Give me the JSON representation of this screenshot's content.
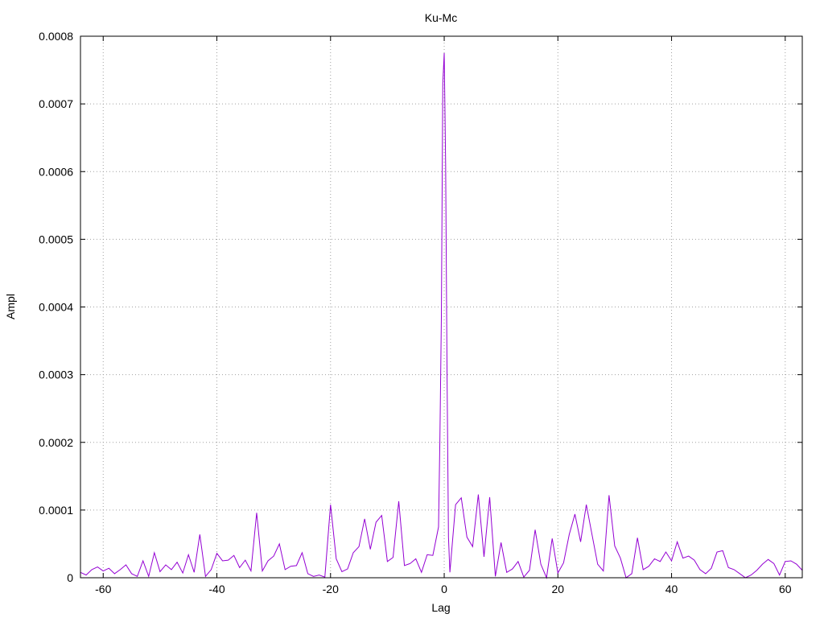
{
  "chart_data": {
    "type": "line",
    "title": "Ku-Mc",
    "xlabel": "Lag",
    "ylabel": "Ampl",
    "xlim": [
      -64,
      63
    ],
    "ylim": [
      0,
      0.0008
    ],
    "x_ticks": [
      -60,
      -40,
      -20,
      0,
      20,
      40,
      60
    ],
    "y_ticks": [
      0,
      0.0001,
      0.0002,
      0.0003,
      0.0004,
      0.0005,
      0.0006,
      0.0007,
      0.0008
    ],
    "x_tick_labels": [
      "-60",
      "-40",
      "-20",
      "0",
      "20",
      "40",
      "60"
    ],
    "y_tick_labels": [
      "0",
      "0.0001",
      "0.0002",
      "0.0003",
      "0.0004",
      "0.0005",
      "0.0006",
      "0.0007",
      "0.0008"
    ],
    "grid": true,
    "legend": "none",
    "colors": {
      "series": "#9400d3",
      "grid": "#a0a0a0",
      "axis": "#000000"
    },
    "series": [
      {
        "x": [
          -64,
          -63,
          -62,
          -61,
          -60,
          -59,
          -58,
          -57,
          -56,
          -55,
          -54,
          -53,
          -52,
          -51,
          -50,
          -49,
          -48,
          -47,
          -46,
          -45,
          -44,
          -43,
          -42,
          -41,
          -40,
          -39,
          -38,
          -37,
          -36,
          -35,
          -34,
          -33,
          -32,
          -31,
          -30,
          -29,
          -28,
          -27,
          -26,
          -25,
          -24,
          -23,
          -22,
          -21,
          -20,
          -19,
          -18,
          -17,
          -16,
          -15,
          -14,
          -13,
          -12,
          -11,
          -10,
          -9,
          -8,
          -7,
          -6,
          -5,
          -4,
          -3,
          -2,
          -1,
          -0.75,
          -0.5,
          -0.25,
          0,
          0.25,
          0.5,
          0.75,
          1,
          2,
          3,
          4,
          5,
          6,
          7,
          8,
          9,
          10,
          11,
          12,
          13,
          14,
          15,
          16,
          17,
          18,
          19,
          20,
          21,
          22,
          23,
          24,
          25,
          26,
          27,
          28,
          29,
          30,
          31,
          32,
          33,
          34,
          35,
          36,
          37,
          38,
          39,
          40,
          41,
          42,
          43,
          44,
          45,
          46,
          47,
          48,
          49,
          50,
          51,
          52,
          53,
          54,
          55,
          56,
          57,
          58,
          59,
          60,
          61,
          62,
          63
        ],
        "values": [
          8e-06,
          4e-06,
          1.2e-05,
          1.6e-05,
          1e-05,
          1.4e-05,
          6e-06,
          1.2e-05,
          1.9e-05,
          6e-06,
          2e-06,
          2.5e-05,
          2e-06,
          3.7e-05,
          9e-06,
          1.9e-05,
          1.2e-05,
          2.3e-05,
          7e-06,
          3.4e-05,
          8e-06,
          6.4e-05,
          2e-06,
          1.2e-05,
          3.6e-05,
          2.5e-05,
          2.6e-05,
          3.3e-05,
          1.5e-05,
          2.6e-05,
          1e-05,
          9.6e-05,
          1e-05,
          2.5e-05,
          3.2e-05,
          5e-05,
          1.2e-05,
          1.7e-05,
          1.8e-05,
          3.7e-05,
          6e-06,
          2e-06,
          4e-06,
          1e-06,
          0.000108,
          2.8e-05,
          9e-06,
          1.3e-05,
          3.7e-05,
          4.6e-05,
          8.7e-05,
          4.2e-05,
          8.2e-05,
          9.2e-05,
          2.4e-05,
          3e-05,
          0.000113,
          1.8e-05,
          2.1e-05,
          2.8e-05,
          8e-06,
          3.4e-05,
          3.3e-05,
          7.5e-05,
          0.00021,
          0.000385,
          0.00073,
          0.000775,
          0.00061,
          0.0003,
          6e-05,
          8e-06,
          0.000108,
          0.000118,
          6e-05,
          4.6e-05,
          0.000123,
          3.1e-05,
          0.000119,
          2e-06,
          5.2e-05,
          8e-06,
          1.3e-05,
          2.4e-05,
          1e-06,
          1.1e-05,
          7.1e-05,
          2e-05,
          0.0,
          5.8e-05,
          7e-06,
          2.2e-05,
          6.4e-05,
          9.4e-05,
          5.3e-05,
          0.000108,
          6.4e-05,
          2e-05,
          1e-05,
          0.000122,
          4.7e-05,
          2.9e-05,
          0.0,
          6e-06,
          5.9e-05,
          1.2e-05,
          1.7e-05,
          2.8e-05,
          2.4e-05,
          3.8e-05,
          2.5e-05,
          5.3e-05,
          2.9e-05,
          3.2e-05,
          2.6e-05,
          1.2e-05,
          6e-06,
          1.4e-05,
          3.8e-05,
          4e-05,
          1.5e-05,
          1.2e-05,
          6e-06,
          0.0,
          4e-06,
          1.1e-05,
          2e-05,
          2.7e-05,
          2.1e-05,
          4e-06,
          2.4e-05,
          2.5e-05,
          2e-05,
          1.1e-05
        ]
      }
    ]
  }
}
